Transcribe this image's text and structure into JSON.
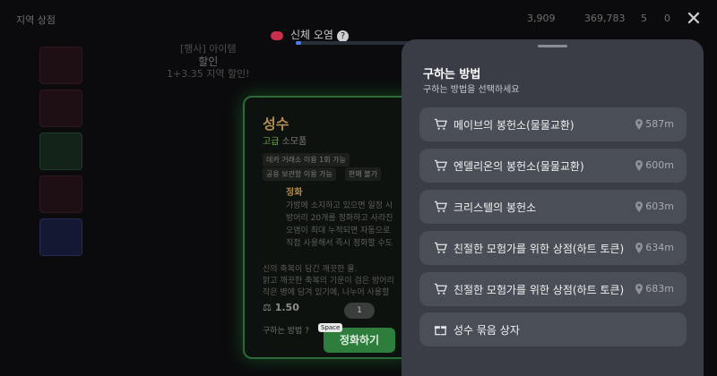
{
  "topbar": {
    "left_label": "지역 상점",
    "stat_1": "3,909",
    "stat_2": "369,783",
    "stat_3": "5",
    "stat_4": "0"
  },
  "promo": {
    "line1": "[행사] 아이템",
    "line2": "할인",
    "line3": "1+3.35 지역 할인!"
  },
  "body_mode": {
    "label": "신체 오염"
  },
  "item": {
    "name": "성수",
    "grade": "고급",
    "type": "소모품",
    "tags": [
      "데카 거래소 이용 1회 가능",
      "공용 보관함 이용 가능",
      "판매 불가"
    ],
    "effect_name": "정화",
    "effect_lines": [
      "가방에 소지하고 있으면 일정 시",
      "방어리 20개를 정화하고 사라진",
      "오염이 최대 누적되면 자동으로",
      "직접 사용해서 즉시 정화할 수도"
    ],
    "description": [
      "신의 축복이 담긴 깨끗한 물.",
      "맑고 깨끗한 축복의 기운이 검은 방어리",
      "작은 병에 담겨 있기에, 나누어 사용할"
    ],
    "weight": "1.50",
    "how_to_get": "구하는 방법",
    "enhance_label": "정화하기",
    "space_key": "Space",
    "count": "1"
  },
  "sheet": {
    "title": "구하는 방법",
    "subtitle": "구하는 방법을 선택하세요",
    "options": [
      {
        "label": "메이브의 봉헌소(물물교환)",
        "distance": "587m",
        "icon": "cart-icon"
      },
      {
        "label": "엔델리온의 봉헌소(물물교환)",
        "distance": "600m",
        "icon": "cart-icon"
      },
      {
        "label": "크리스텔의 봉헌소",
        "distance": "603m",
        "icon": "cart-icon"
      },
      {
        "label": "친절한 모험가를 위한 상점(하트 토큰)",
        "distance": "634m",
        "icon": "cart-icon"
      },
      {
        "label": "친절한 모험가를 위한 상점(하트 토큰)",
        "distance": "683m",
        "icon": "cart-icon"
      },
      {
        "label": "성수 묶음 상자",
        "distance": "",
        "icon": "gift-icon"
      }
    ]
  }
}
